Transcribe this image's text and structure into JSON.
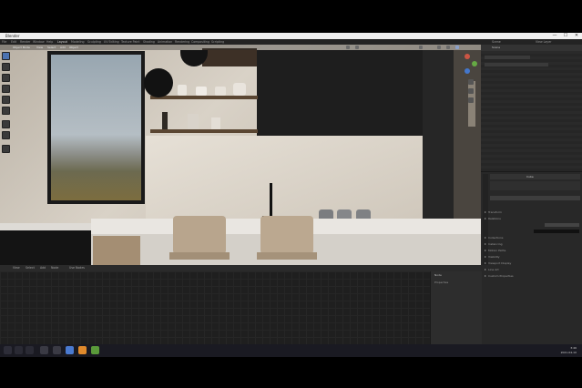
{
  "window": {
    "title": "Blender",
    "controls": {
      "minimize": "—",
      "maximize": "☐",
      "close": "✕"
    }
  },
  "menubar": {
    "items": [
      "File",
      "Edit",
      "Render",
      "Window",
      "Help",
      "Layout",
      "Modeling",
      "Sculpting",
      "UV Editing",
      "Texture Paint",
      "Shading",
      "Animation",
      "Rendering",
      "Compositing",
      "Scripting"
    ],
    "scene": "Scene",
    "view_layer": "View Layer"
  },
  "viewport": {
    "mode": "Object Mode",
    "view_menu": [
      "View",
      "Select",
      "Add",
      "Object"
    ],
    "tools": [
      "select-box",
      "cursor",
      "move",
      "rotate",
      "scale",
      "transform",
      "annotate",
      "measure",
      "add-cube"
    ]
  },
  "properties": {
    "header_label": "Scene",
    "sections": [
      "Transform",
      "Relations",
      "Collections",
      "Instancing",
      "Motion Paths",
      "Visibility",
      "Viewport Display",
      "Line Art",
      "Custom Properties"
    ],
    "object_name": "Cube"
  },
  "lower_editor": {
    "menus": [
      "View",
      "Select",
      "Add",
      "Node",
      "Use Nodes"
    ],
    "npanel_title": "Node",
    "npanel_sub": "Properties"
  },
  "colors": {
    "accent": "#4b72b0",
    "window_bg": "#2b2b2b",
    "marble": "#d6cfc4",
    "cabinet": "#1b1b1b",
    "chair_wood": "#b8a58d"
  },
  "taskbar": {
    "time": "3:46",
    "date": "2021-04-10"
  }
}
